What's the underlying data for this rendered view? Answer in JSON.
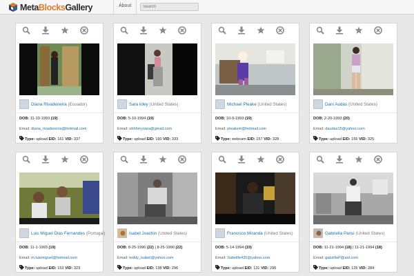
{
  "header": {
    "logo_meta": "Meta",
    "logo_blocks": "Blocks",
    "logo_gallery": "Gallery",
    "about_label": "About",
    "search_placeholder": "Search"
  },
  "labels": {
    "dob": "DOB:",
    "email": "Email:",
    "type": "Type:",
    "eid": "EID:",
    "vid": "VID:"
  },
  "icons": [
    "search-icon",
    "download-icon",
    "star-icon",
    "close-circle-icon",
    "tag-icon"
  ],
  "colors": {
    "link": "#1a6fb0",
    "logo_accent": "#e07a2a",
    "icon_gray": "#8a8a8a"
  },
  "cards": [
    {
      "name": "Diana Rivadeneira",
      "country": "(Ecuador)",
      "dob": "11-10-1993",
      "age": "(19)",
      "email": "diana_rivadeneira@hotmail.com",
      "type": "upload",
      "eid": "161",
      "vid": "337"
    },
    {
      "name": "Sara kiley",
      "country": "(United States)",
      "dob": "5-10-1994",
      "age": "(19)",
      "email": "ohhhmysara@gmail.com",
      "type": "upload",
      "eid": "160",
      "vid": "333"
    },
    {
      "name": "Michael Pleake",
      "country": "(United States)",
      "dob": "10-9-1993",
      "age": "(19)",
      "email": "pleakem@hotmail.com",
      "type": "webcam",
      "eid": "157",
      "vid": "328"
    },
    {
      "name": "Dani Audas",
      "country": "(United States)",
      "dob": "2-20-1993",
      "age": "(20)",
      "email": "daudas15@yahoo.com",
      "type": "upload",
      "eid": "155",
      "vid": "325"
    },
    {
      "name": "Luis Miguel Dias Fernandes",
      "country": "(Portugal)",
      "dob": "11-1-1993",
      "age": "(19)",
      "email": "m.luismiguel@hotmail.com",
      "type": "upload",
      "eid": "153",
      "vid": "323"
    },
    {
      "name": "Isabel Joachin",
      "country": "(United States)",
      "dob": "8-25-1990",
      "age": "(22)",
      "dob2": "8-25-1990",
      "age2": "(22)",
      "email": "teddy_isabel@yahoo.com",
      "type": "upload",
      "eid": "138",
      "vid": "296"
    },
    {
      "name": "Francisco Miranda",
      "country": "(United States)",
      "dob": "5-14-1994",
      "age": "(19)",
      "email": "Suitelife435@yahoo.com",
      "type": "upload",
      "eid": "131",
      "vid": "290"
    },
    {
      "name": "Gabriella Parisi",
      "country": "(United States)",
      "dob": "11-21-1994",
      "age": "(18)",
      "dob2": "11-21-1994",
      "age2": "(18)",
      "email": "gabzillaP@aol.com",
      "type": "upload",
      "eid": "126",
      "vid": "284"
    }
  ]
}
